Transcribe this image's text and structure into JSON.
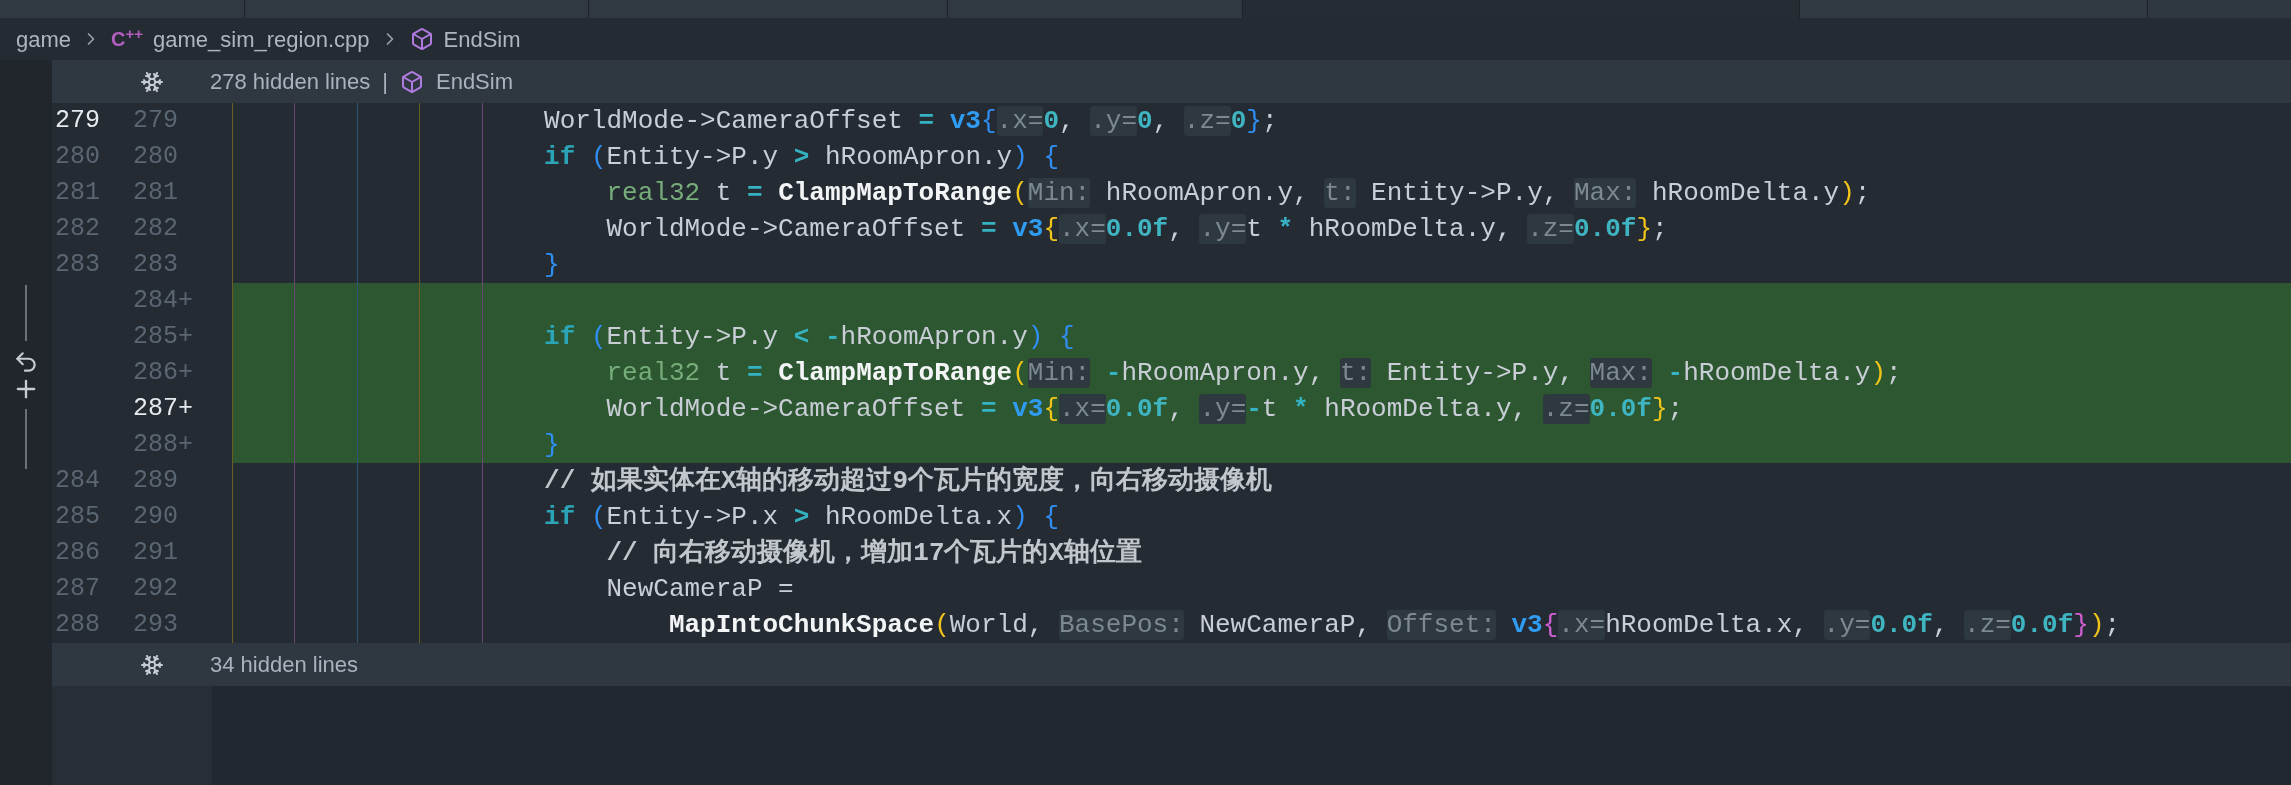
{
  "tabs": [
    {
      "selected": false
    },
    {
      "selected": false
    },
    {
      "selected": false
    },
    {
      "selected": false
    },
    {
      "selected": true
    },
    {
      "selected": false
    }
  ],
  "breadcrumb": {
    "folder": "game",
    "file_icon": "C$^{++}$",
    "file": "game_sim_region.cpp",
    "symbol": "EndSim"
  },
  "hidden_top": {
    "label": "278 hidden lines",
    "separator": "|",
    "symbol": "EndSim"
  },
  "lines": [
    {
      "old_number": "279",
      "old_active": true,
      "new_number": "279",
      "new_active": false,
      "added": false,
      "tokens": [
        {
          "kind": "plain",
          "t": "                    WorldMode->CameraOffset "
        },
        {
          "kind": "op",
          "t": "="
        },
        {
          "kind": "struct",
          "t": " v3"
        },
        {
          "kind": "pblue",
          "t": "{"
        },
        {
          "kind": "hint",
          "t": ".x="
        },
        {
          "kind": "num",
          "t": "0"
        },
        {
          "kind": "plain",
          "t": ", "
        },
        {
          "kind": "hint",
          "t": ".y="
        },
        {
          "kind": "num",
          "t": "0"
        },
        {
          "kind": "plain",
          "t": ", "
        },
        {
          "kind": "hint",
          "t": ".z="
        },
        {
          "kind": "num",
          "t": "0"
        },
        {
          "kind": "pblue",
          "t": "}"
        },
        {
          "kind": "plain",
          "t": ";"
        }
      ]
    },
    {
      "old_number": "280",
      "old_active": false,
      "new_number": "280",
      "new_active": false,
      "added": false,
      "tokens": [
        {
          "kind": "kw",
          "t": "                    if"
        },
        {
          "kind": "pblue",
          "t": " ("
        },
        {
          "kind": "plain",
          "t": "Entity->P.y "
        },
        {
          "kind": "op",
          "t": ">"
        },
        {
          "kind": "plain",
          "t": " hRoomApron.y"
        },
        {
          "kind": "pblue",
          "t": ")"
        },
        {
          "kind": "pblue",
          "t": " {"
        }
      ]
    },
    {
      "old_number": "281",
      "old_active": false,
      "new_number": "281",
      "new_active": false,
      "added": false,
      "tokens": [
        {
          "kind": "type",
          "t": "                        real32"
        },
        {
          "kind": "plain",
          "t": " t "
        },
        {
          "kind": "op",
          "t": "="
        },
        {
          "kind": "fn",
          "t": " ClampMapToRange"
        },
        {
          "kind": "pyellow",
          "t": "("
        },
        {
          "kind": "hint",
          "t": "Min:"
        },
        {
          "kind": "plain",
          "t": " hRoomApron.y, "
        },
        {
          "kind": "hint",
          "t": "t:"
        },
        {
          "kind": "plain",
          "t": " Entity->P.y, "
        },
        {
          "kind": "hint",
          "t": "Max:"
        },
        {
          "kind": "plain",
          "t": " hRoomDelta.y"
        },
        {
          "kind": "pyellow",
          "t": ")"
        },
        {
          "kind": "plain",
          "t": ";"
        }
      ]
    },
    {
      "old_number": "282",
      "old_active": false,
      "new_number": "282",
      "new_active": false,
      "added": false,
      "tokens": [
        {
          "kind": "plain",
          "t": "                        WorldMode->CameraOffset "
        },
        {
          "kind": "op",
          "t": "="
        },
        {
          "kind": "struct",
          "t": " v3"
        },
        {
          "kind": "pyellow",
          "t": "{"
        },
        {
          "kind": "hint",
          "t": ".x="
        },
        {
          "kind": "num",
          "t": "0.0f"
        },
        {
          "kind": "plain",
          "t": ", "
        },
        {
          "kind": "hint",
          "t": ".y="
        },
        {
          "kind": "plain",
          "t": "t "
        },
        {
          "kind": "op",
          "t": "*"
        },
        {
          "kind": "plain",
          "t": " hRoomDelta.y, "
        },
        {
          "kind": "hint",
          "t": ".z="
        },
        {
          "kind": "num",
          "t": "0.0f"
        },
        {
          "kind": "pyellow",
          "t": "}"
        },
        {
          "kind": "plain",
          "t": ";"
        }
      ]
    },
    {
      "old_number": "283",
      "old_active": false,
      "new_number": "283",
      "new_active": false,
      "added": false,
      "tokens": [
        {
          "kind": "pblue",
          "t": "                    }"
        }
      ]
    },
    {
      "new_number": "284+",
      "new_active": false,
      "added": true
    },
    {
      "new_number": "285+",
      "new_active": false,
      "added": true,
      "tokens": [
        {
          "kind": "kw",
          "t": "                    if"
        },
        {
          "kind": "pblue",
          "t": " ("
        },
        {
          "kind": "plain",
          "t": "Entity->P.y "
        },
        {
          "kind": "op",
          "t": "<"
        },
        {
          "kind": "op",
          "t": " -"
        },
        {
          "kind": "plain",
          "t": "hRoomApron.y"
        },
        {
          "kind": "pblue",
          "t": ")"
        },
        {
          "kind": "pblue",
          "t": " {"
        }
      ]
    },
    {
      "new_number": "286+",
      "new_active": false,
      "added": true,
      "tokens": [
        {
          "kind": "type",
          "t": "                        real32"
        },
        {
          "kind": "plain",
          "t": " t "
        },
        {
          "kind": "op",
          "t": "="
        },
        {
          "kind": "fn",
          "t": " ClampMapToRange"
        },
        {
          "kind": "pyellow",
          "t": "("
        },
        {
          "kind": "hint",
          "t": "Min:"
        },
        {
          "kind": "op",
          "t": " -"
        },
        {
          "kind": "plain",
          "t": "hRoomApron.y, "
        },
        {
          "kind": "hint",
          "t": "t:"
        },
        {
          "kind": "plain",
          "t": " Entity->P.y, "
        },
        {
          "kind": "hint",
          "t": "Max:"
        },
        {
          "kind": "op",
          "t": " -"
        },
        {
          "kind": "plain",
          "t": "hRoomDelta.y"
        },
        {
          "kind": "pyellow",
          "t": ")"
        },
        {
          "kind": "plain",
          "t": ";"
        }
      ]
    },
    {
      "new_number": "287+",
      "new_active": true,
      "added": true,
      "tokens": [
        {
          "kind": "plain",
          "t": "                        WorldMode->CameraOffset "
        },
        {
          "kind": "op",
          "t": "="
        },
        {
          "kind": "struct",
          "t": " v3"
        },
        {
          "kind": "pyellow",
          "t": "{"
        },
        {
          "kind": "hint",
          "t": ".x="
        },
        {
          "kind": "num",
          "t": "0.0f"
        },
        {
          "kind": "plain",
          "t": ", "
        },
        {
          "kind": "hint",
          "t": ".y="
        },
        {
          "kind": "op",
          "t": "-"
        },
        {
          "kind": "plain",
          "t": "t "
        },
        {
          "kind": "op",
          "t": "*"
        },
        {
          "kind": "plain",
          "t": " hRoomDelta.y, "
        },
        {
          "kind": "hint",
          "t": ".z="
        },
        {
          "kind": "num",
          "t": "0.0f"
        },
        {
          "kind": "pyellow",
          "t": "}"
        },
        {
          "kind": "plain",
          "t": ";"
        }
      ]
    },
    {
      "new_number": "288+",
      "new_active": false,
      "added": true,
      "tokens": [
        {
          "kind": "pblue",
          "t": "                    }"
        }
      ]
    },
    {
      "old_number": "284",
      "old_active": false,
      "new_number": "289",
      "new_active": false,
      "added": false,
      "tokens": [
        {
          "kind": "comment",
          "t": "                    // 如果实体在X轴的移动超过9个瓦片的宽度，向右移动摄像机"
        }
      ]
    },
    {
      "old_number": "285",
      "old_active": false,
      "new_number": "290",
      "new_active": false,
      "added": false,
      "tokens": [
        {
          "kind": "kw",
          "t": "                    if"
        },
        {
          "kind": "pblue",
          "t": " ("
        },
        {
          "kind": "plain",
          "t": "Entity->P.x "
        },
        {
          "kind": "op",
          "t": ">"
        },
        {
          "kind": "plain",
          "t": " hRoomDelta.x"
        },
        {
          "kind": "pblue",
          "t": ")"
        },
        {
          "kind": "pblue",
          "t": " {"
        }
      ]
    },
    {
      "old_number": "286",
      "old_active": false,
      "new_number": "291",
      "new_active": false,
      "added": false,
      "tokens": [
        {
          "kind": "comment",
          "t": "                        // 向右移动摄像机，增加17个瓦片的X轴位置"
        }
      ]
    },
    {
      "old_number": "287",
      "old_active": false,
      "new_number": "292",
      "new_active": false,
      "added": false,
      "tokens": [
        {
          "kind": "plain",
          "t": "                        NewCameraP ="
        }
      ]
    },
    {
      "old_number": "288",
      "old_active": false,
      "new_number": "293",
      "new_active": false,
      "added": false,
      "tokens": [
        {
          "kind": "fn",
          "t": "                            MapIntoChunkSpace"
        },
        {
          "kind": "pyellow",
          "t": "("
        },
        {
          "kind": "plain",
          "t": "World, "
        },
        {
          "kind": "hint",
          "t": "BasePos:"
        },
        {
          "kind": "plain",
          "t": " NewCameraP, "
        },
        {
          "kind": "hint",
          "t": "Offset:"
        },
        {
          "kind": "struct",
          "t": " v3"
        },
        {
          "kind": "ppink",
          "t": "{"
        },
        {
          "kind": "hint",
          "t": ".x="
        },
        {
          "kind": "plain",
          "t": "hRoomDelta.x, "
        },
        {
          "kind": "hint",
          "t": ".y="
        },
        {
          "kind": "num",
          "t": "0.0f"
        },
        {
          "kind": "plain",
          "t": ", "
        },
        {
          "kind": "hint",
          "t": ".z="
        },
        {
          "kind": "num",
          "t": "0.0f"
        },
        {
          "kind": "ppink",
          "t": "}"
        },
        {
          "kind": "pyellow",
          "t": ")"
        },
        {
          "kind": "plain",
          "t": ";"
        }
      ]
    }
  ],
  "hidden_bottom": {
    "label": "34 hidden lines"
  }
}
